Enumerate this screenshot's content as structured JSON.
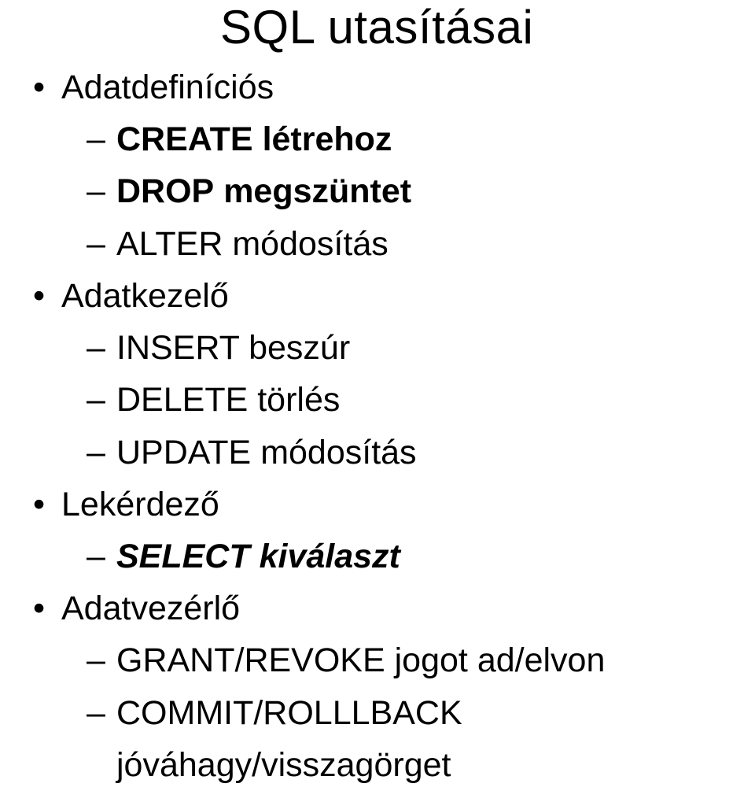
{
  "title": "SQL utasításai",
  "sections": [
    {
      "heading": "Adatdefiníciós",
      "items": [
        {
          "cmd": "CREATE",
          "desc": "létrehoz",
          "style": "bold"
        },
        {
          "cmd": "DROP",
          "desc": "megszüntet",
          "style": "bold"
        },
        {
          "cmd": "ALTER",
          "desc": "módosítás",
          "style": "plain"
        }
      ]
    },
    {
      "heading": "Adatkezelő",
      "items": [
        {
          "cmd": "INSERT",
          "desc": "beszúr",
          "style": "plain"
        },
        {
          "cmd": "DELETE",
          "desc": "törlés",
          "style": "plain"
        },
        {
          "cmd": "UPDATE",
          "desc": "módosítás",
          "style": "plain"
        }
      ]
    },
    {
      "heading": "Lekérdező",
      "items": [
        {
          "cmd": "SELECT",
          "desc": "kiválaszt",
          "style": "bolditalic"
        }
      ]
    },
    {
      "heading": "Adatvezérlő",
      "items": [
        {
          "cmd": "GRANT/REVOKE",
          "desc": "jogot ad/elvon",
          "style": "plain"
        },
        {
          "cmd": "COMMIT/ROLLLBACK",
          "desc": "jóváhagy/visszagörget",
          "style": "plain"
        }
      ]
    }
  ]
}
